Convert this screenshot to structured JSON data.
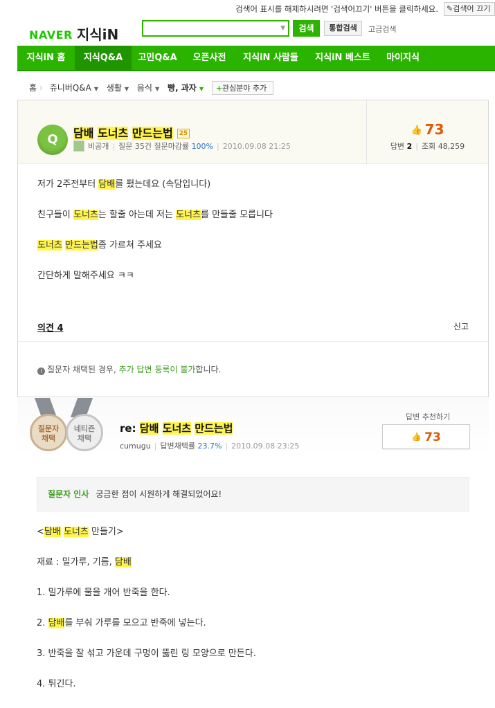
{
  "topbar": {
    "message": "검색어 표시를 해제하시려면 '검색어끄기' 버튼을 클릭하세요.",
    "off_button": "검색어 끄기"
  },
  "header": {
    "logo_naver": "NAVER",
    "logo_kin": "지식iN",
    "search_value": "",
    "search_button": "검색",
    "integrated_button": "통합검색",
    "advanced_link": "고급검색"
  },
  "nav": {
    "items": [
      "지식iN 홈",
      "지식Q&A",
      "고민Q&A",
      "오픈사전",
      "지식iN 사람들",
      "지식iN 베스트",
      "마이지식"
    ],
    "active": "지식Q&A"
  },
  "breadcrumb": {
    "items": [
      "홈",
      "쥬니버Q&A",
      "생활",
      "음식",
      "빵, 과자"
    ],
    "add_interest": "관심분야 추가"
  },
  "question": {
    "icon_letter": "Q",
    "title_parts": [
      "담배",
      "도너츠",
      "만드는법"
    ],
    "points_badge": "25",
    "author": "비공개",
    "question_count": "질문 35건",
    "close_rate_label": "질문마감률",
    "close_rate": "100%",
    "date": "2010.09.08 21:25",
    "recommend_count": "73",
    "answers_label": "답변",
    "answers_count": "2",
    "views_label": "조회",
    "views_count": "48,259",
    "body": {
      "l1_a": "저가 2주전부터 ",
      "l1_hl": "담배",
      "l1_b": "를 폈는데요 (속담입니다)",
      "l2_a": "친구들이 ",
      "l2_hl1": "도너츠",
      "l2_b": "는 할줄 아는데 저는 ",
      "l2_hl2": "도너츠",
      "l2_c": "를 만들줄 모릅니다",
      "l3_hl1": "도너츠",
      "l3_hl2": "만드는법",
      "l3_b": "좀 가르쳐 주세요",
      "l4": "간단하게 말해주세요 ㅋㅋ"
    },
    "opinions": "의견 4",
    "report": "신고",
    "notice_a": "질문자 채택된 경우, ",
    "notice_b": "추가 답변 등록이 불가",
    "notice_c": "합니다."
  },
  "answer": {
    "medal_1": [
      "질문자",
      "채택"
    ],
    "medal_2": [
      "네티즌",
      "채택"
    ],
    "title_prefix": "re: ",
    "title_parts": [
      "담배",
      "도너츠",
      "만드는법"
    ],
    "author": "cumugu",
    "adopt_rate_label": "답변채택률",
    "adopt_rate": "23.7%",
    "date": "2010.09.08 23:25",
    "recommend_label": "답변 추천하기",
    "recommend_count": "73",
    "greeting_label": "질문자 인사",
    "greeting_text": "궁금한 점이 시원하게 해결되었어요!",
    "body": {
      "l1_a": "<",
      "l1_hl1": "담배",
      "l1_hl2": "도너츠",
      "l1_b": " 만들기>",
      "l2_a": "재료 : 밀가루, 기름, ",
      "l2_hl": "담배",
      "l3": "1. 밀가루에 물을 개어 반죽을 한다.",
      "l4_a": "2. ",
      "l4_hl": "담배",
      "l4_b": "를 부숴 가루를 모으고 반죽에 넣는다.",
      "l5": "3. 반죽을 잘 섞고 가운데 구멍이 뚫린 링 모양으로 만든다.",
      "l6": "4. 튀긴다."
    }
  },
  "colors": {
    "brand_green": "#2ab400",
    "highlight": "#fff34d",
    "score_orange": "#e05a00"
  }
}
